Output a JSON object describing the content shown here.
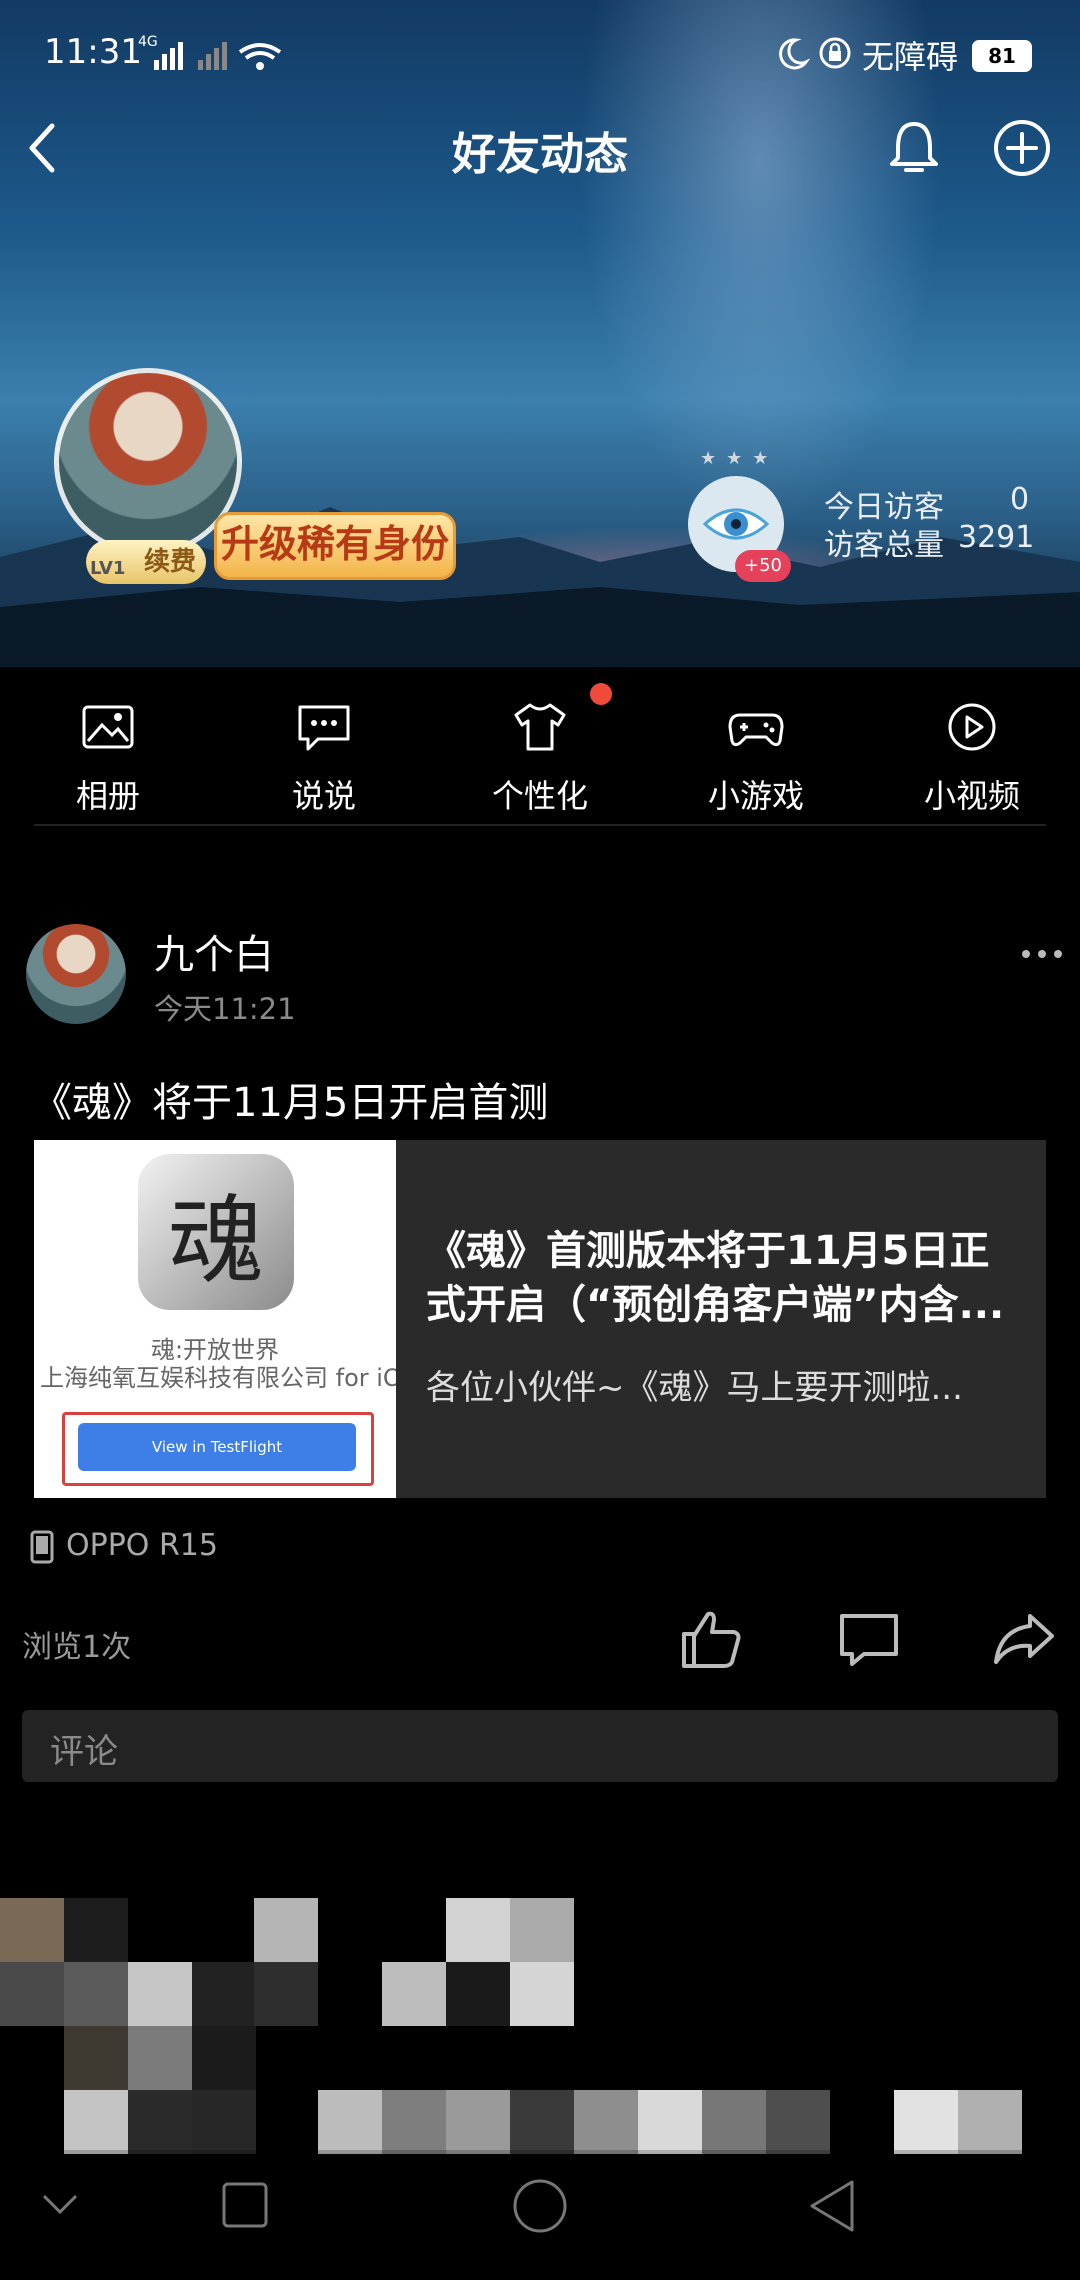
{
  "status_bar": {
    "time": "11:31",
    "network": "4G",
    "accessibility": "无障碍",
    "battery": "81"
  },
  "header": {
    "title": "好友动态"
  },
  "profile": {
    "upgrade_label": "升级稀有身份",
    "renew_label": "续费",
    "level": "LV1",
    "eye_bonus": "+50",
    "today_visitors_label": "今日访客",
    "today_visitors_value": "0",
    "total_visitors_label": "访客总量",
    "total_visitors_value": "3291"
  },
  "tabs": [
    {
      "label": "相册",
      "icon": "album-icon"
    },
    {
      "label": "说说",
      "icon": "message-icon"
    },
    {
      "label": "个性化",
      "icon": "tshirt-icon",
      "badge": true
    },
    {
      "label": "小游戏",
      "icon": "gamepad-icon"
    },
    {
      "label": "小视频",
      "icon": "play-icon"
    }
  ],
  "post": {
    "author": "九个白",
    "time": "今天11:21",
    "text": "《魂》将于11月5日开启首测",
    "link_card": {
      "app_glyph": "魂",
      "app_name": "魂:开放世界",
      "app_company": "上海纯氧互娱科技有限公司 for iO",
      "testflight_button": "View in TestFlight",
      "title": "《魂》首测版本将于11月5日正式开启（“预创角客户端”内含...",
      "description": "各位小伙伴~《魂》马上要开测啦..."
    },
    "device": "OPPO R15",
    "views": "浏览1次",
    "comment_placeholder": "评论"
  },
  "colors": {
    "accent_red": "#e6415b",
    "upgrade_gold": "#f3b54a",
    "testflight_blue": "#3d7fe6"
  }
}
